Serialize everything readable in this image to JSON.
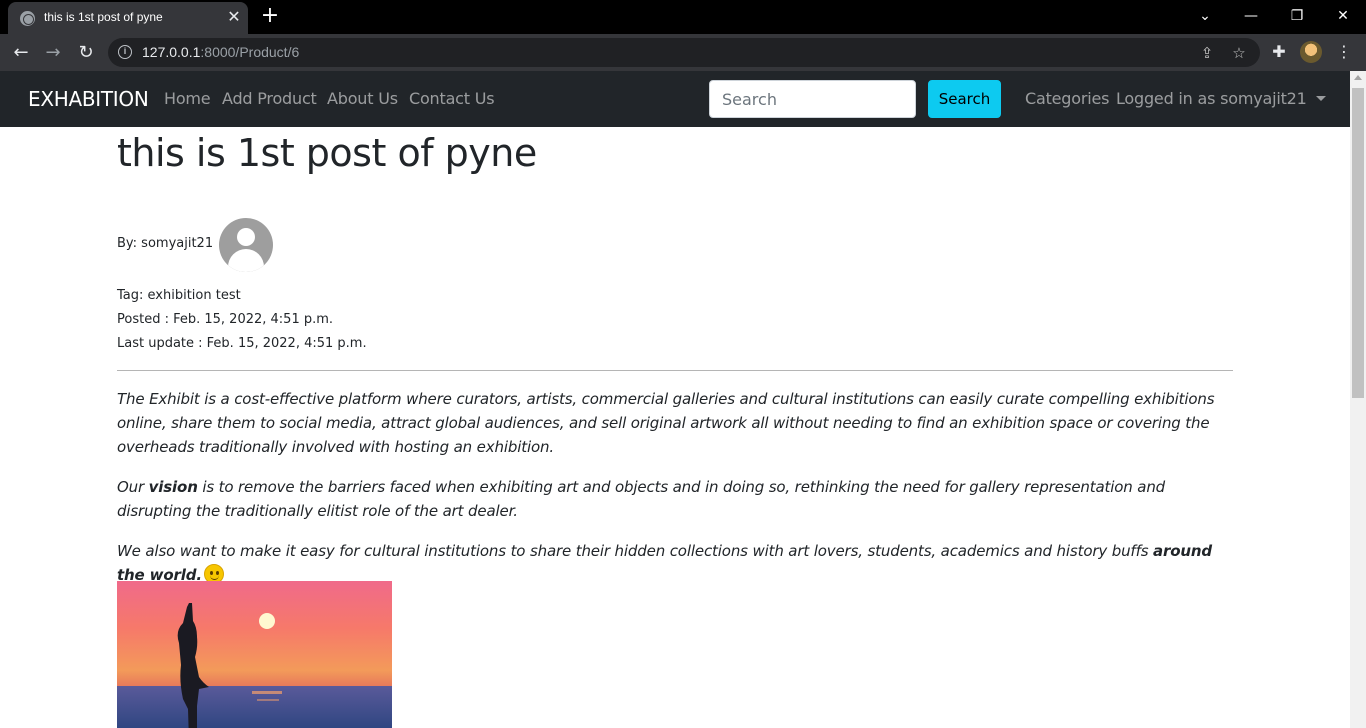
{
  "browser": {
    "tab_title": "this is 1st post of pyne",
    "url_host": "127.0.0.1",
    "url_path": ":8000/Product/6"
  },
  "navbar": {
    "brand": "EXHABITION",
    "links": [
      "Home",
      "Add Product",
      "About Us",
      "Contact Us"
    ],
    "search_placeholder": "Search",
    "search_button": "Search",
    "categories": "Categories",
    "user": "Logged in as somyajit21"
  },
  "post": {
    "title": "this is 1st post of pyne",
    "author_label": "By: somyajit21",
    "tag_label": "Tag: exhibition test",
    "posted_label": "Posted : Feb. 15, 2022, 4:51 p.m.",
    "updated_label": "Last update : Feb. 15, 2022, 4:51 p.m.",
    "para1": "The Exhibit is a cost-effective platform where curators, artists, commercial galleries and cultural institutions can easily curate compelling exhibitions online, share them to social media, attract global audiences, and sell original artwork all without needing to find an exhibition space or covering the overheads traditionally involved with hosting an exhibition.",
    "para2_pre": "Our ",
    "para2_bold": "vision",
    "para2_post": " is to remove the barriers faced when exhibiting art and objects and in doing so, rethinking the need for gallery representation and disrupting the traditionally elitist role of the art dealer.",
    "para3_pre": "We also want to make it easy for cultural institutions to share their hidden collections with art lovers, students, academics and history buffs ",
    "para3_bold": "around the world."
  },
  "colors": {
    "navbar_bg": "#212529",
    "search_button_bg": "#0dcaf0"
  }
}
